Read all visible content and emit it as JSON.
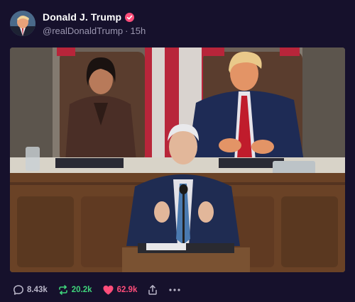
{
  "post": {
    "author": {
      "display_name": "Donald J. Trump",
      "handle": "@realDonaldTrump",
      "separator": "·",
      "timestamp": "15h",
      "verified_icon": "verified-check-icon"
    },
    "media": {
      "type": "photo"
    },
    "actions": {
      "reply": {
        "icon": "reply-bubble-icon",
        "count": "8.43k"
      },
      "repost": {
        "icon": "repost-arrows-icon",
        "count": "20.2k"
      },
      "like": {
        "icon": "heart-icon",
        "count": "62.9k"
      },
      "share": {
        "icon": "share-icon"
      },
      "more": {
        "icon": "more-dots-icon"
      }
    },
    "colors": {
      "background": "#16112c",
      "muted_text": "#9b97b0",
      "repost": "#3fd47b",
      "like": "#ff4d7a",
      "verified": "#ff4d7a"
    }
  }
}
